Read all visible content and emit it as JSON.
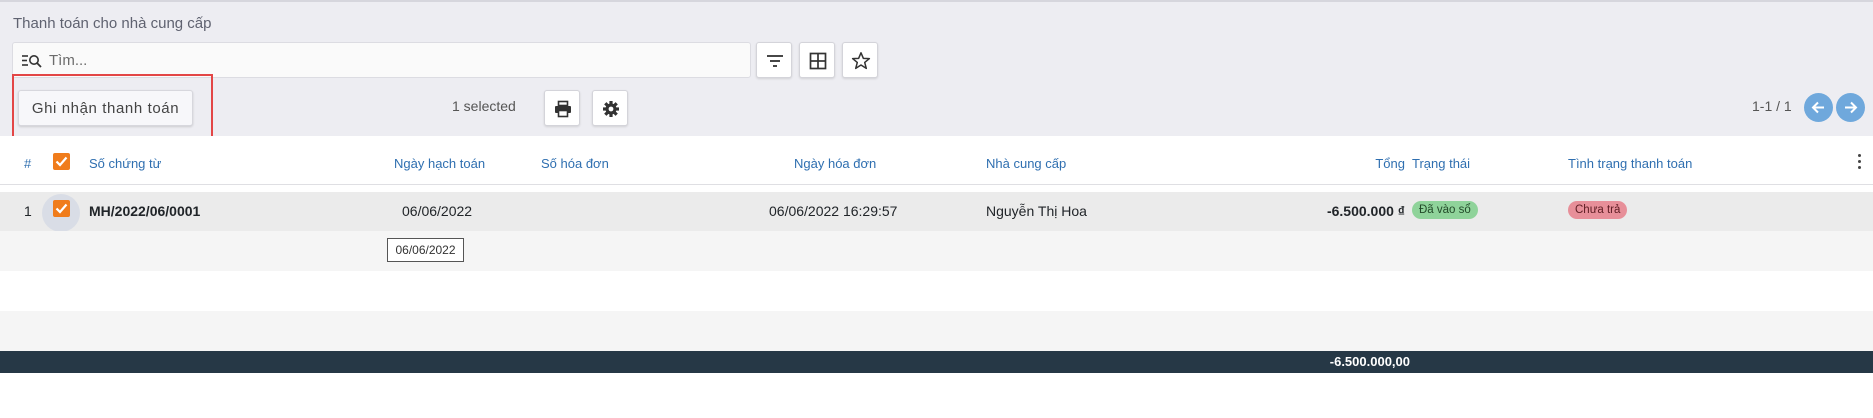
{
  "breadcrumb": "Thanh toán cho nhà cung cấp",
  "search": {
    "placeholder": "Tìm..."
  },
  "toolbar": {
    "filter_icon": "filter-icon",
    "grid_icon": "grid-view-icon",
    "favorite_icon": "star-icon",
    "print_icon": "printer-icon",
    "settings_icon": "gear-icon"
  },
  "actions": {
    "record_payment_label": "Ghi nhận thanh toán"
  },
  "selection": {
    "count_label": "1 selected"
  },
  "pager": {
    "label": "1-1 / 1"
  },
  "table": {
    "headers": {
      "num": "#",
      "document_no": "Số chứng từ",
      "accounting_date": "Ngày hạch toán",
      "invoice_no": "Số hóa đơn",
      "invoice_date": "Ngày hóa đơn",
      "supplier": "Nhà cung cấp",
      "total": "Tổng",
      "status": "Trạng thái",
      "payment_status": "Tình trạng thanh toán"
    },
    "rows": [
      {
        "num": "1",
        "checked": true,
        "document_no": "MH/2022/06/0001",
        "accounting_date": "06/06/2022",
        "invoice_no": "",
        "invoice_date": "06/06/2022 16:29:57",
        "supplier": "Nguyễn Thị Hoa",
        "total": "-6.500.000 ₫",
        "status": "Đã vào sổ",
        "payment_status": "Chưa trả"
      }
    ],
    "tooltip": "06/06/2022",
    "footer_total": "-6.500.000,00"
  },
  "colors": {
    "header_bg": "#ededf2",
    "accent_checkbox": "#f07c1b",
    "column_header": "#2f6fb0",
    "footer_bg": "#263846",
    "badge_posted": "#8fd39a",
    "badge_unpaid": "#e78f99",
    "pager_button": "#6fa8dc",
    "highlight_box": "#e34646"
  }
}
